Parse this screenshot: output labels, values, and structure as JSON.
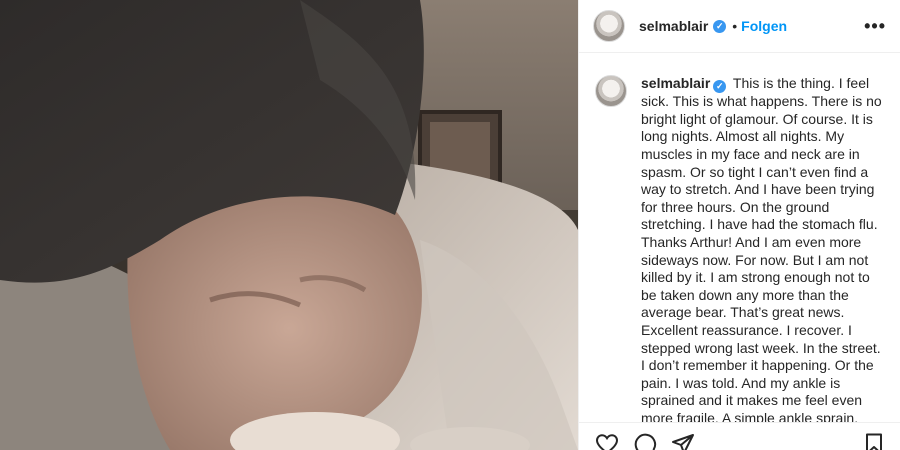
{
  "post": {
    "username": "selmablair",
    "follow_label": "Folgen",
    "separator": "•",
    "more_label": "•••",
    "verified_mark": "✓",
    "caption": "This is the thing. I feel sick. This is what happens. There is no bright light of glamour. Of course. It is long nights. Almost all nights. My muscles in my face and neck are in spasm. Or so tight I can’t even find a way to stretch. And I have been trying for three hours. On the ground stretching. I have had the stomach flu. Thanks Arthur! And I am even more sideways now. For now. But I am not killed by it. I am strong enough not to be taken down any more than the average bear. That’s great news. Excellent reassurance. I recover. I stepped wrong last week. In the street. I don’t remember it happening. Or the pain. I was told. And my ankle is sprained and it makes me feel even more fragile. A simple ankle sprain."
  },
  "icons": {
    "like": "heart-icon",
    "comment": "comment-icon",
    "share": "paper-plane-icon",
    "save": "bookmark-icon"
  },
  "colors": {
    "link_blue": "#0095f6",
    "verified_blue": "#3897f0",
    "text": "#262626"
  }
}
